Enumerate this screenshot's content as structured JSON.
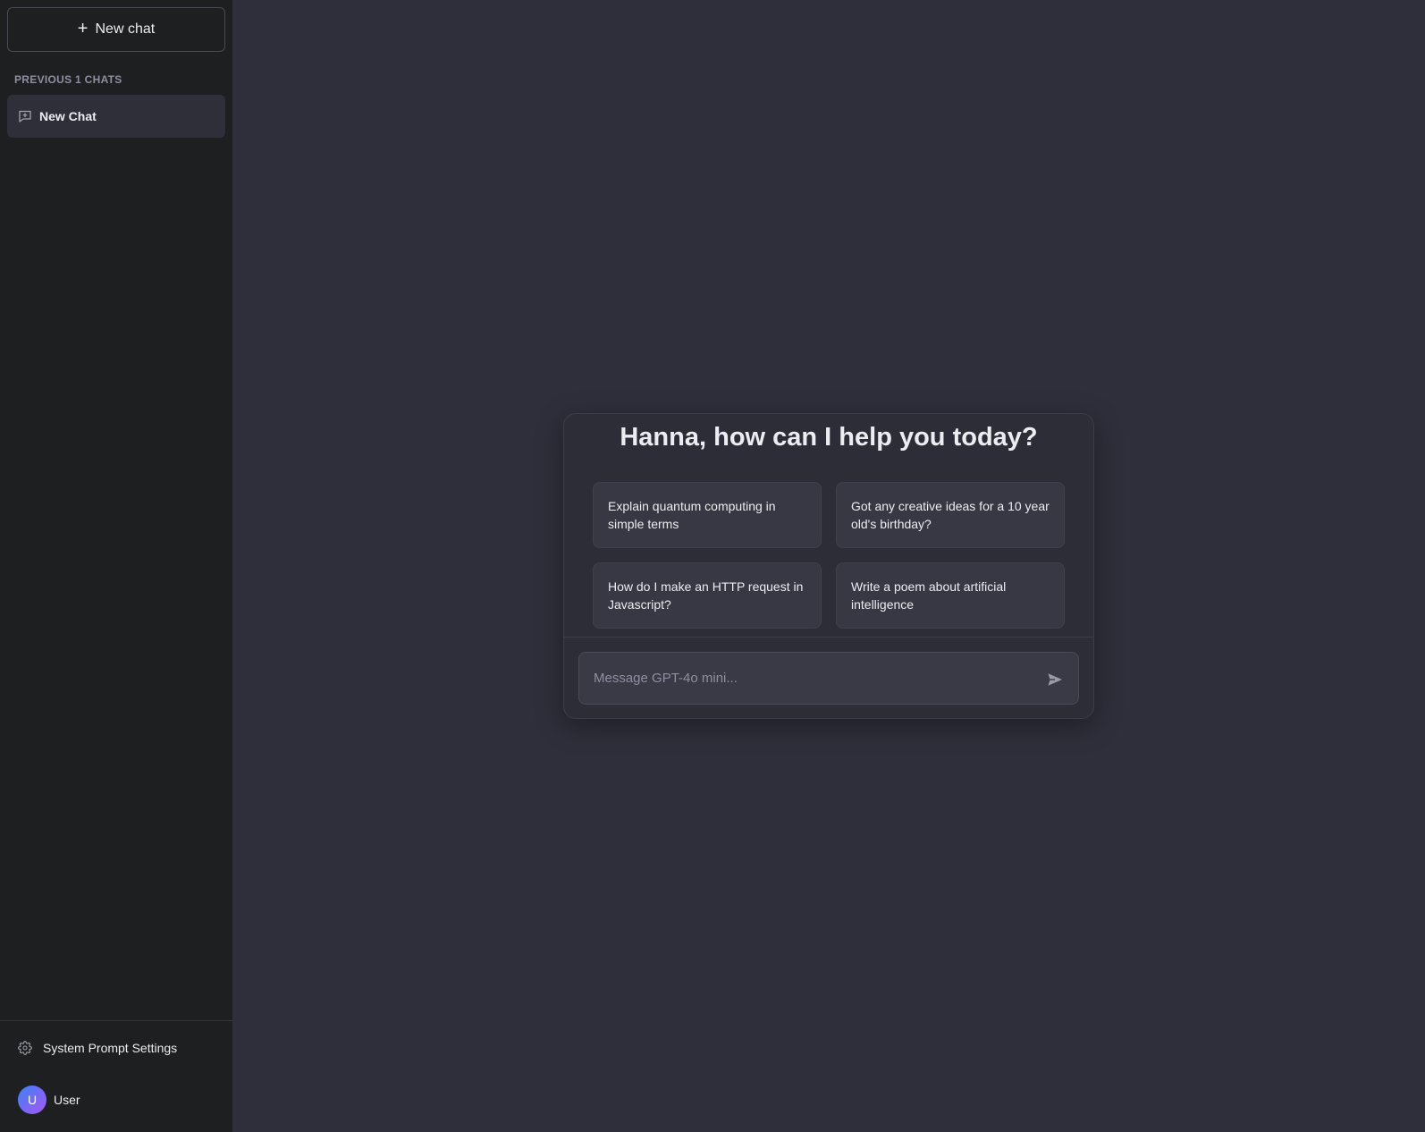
{
  "sidebar": {
    "new_chat_label": "New chat",
    "section_label": "PREVIOUS 1 CHATS",
    "chats": [
      {
        "label": "New Chat",
        "icon": "chat-icon"
      }
    ],
    "footer": {
      "settings_label": "System Prompt Settings",
      "settings_icon": "gear-icon",
      "user_initial": "U",
      "user_name": "User"
    }
  },
  "main": {
    "greeting": "Hanna, how can I help you today?",
    "suggestions": [
      "Explain quantum computing in simple terms",
      "Got any creative ideas for a 10 year old's birthday?",
      "How do I make an HTTP request in Javascript?",
      "Write a poem about artificial intelligence"
    ],
    "input": {
      "placeholder": "Message GPT-4o mini...",
      "value": ""
    }
  },
  "colors": {
    "sidebar_bg": "#1e1f21",
    "main_bg": "#2e2f3a",
    "card_bg": "#2c2d37",
    "suggestion_bg": "#373843",
    "text": "#ececf1",
    "muted": "#8e8ea0",
    "avatar_gradient_start": "#3b82f6",
    "avatar_gradient_end": "#a855f7"
  }
}
